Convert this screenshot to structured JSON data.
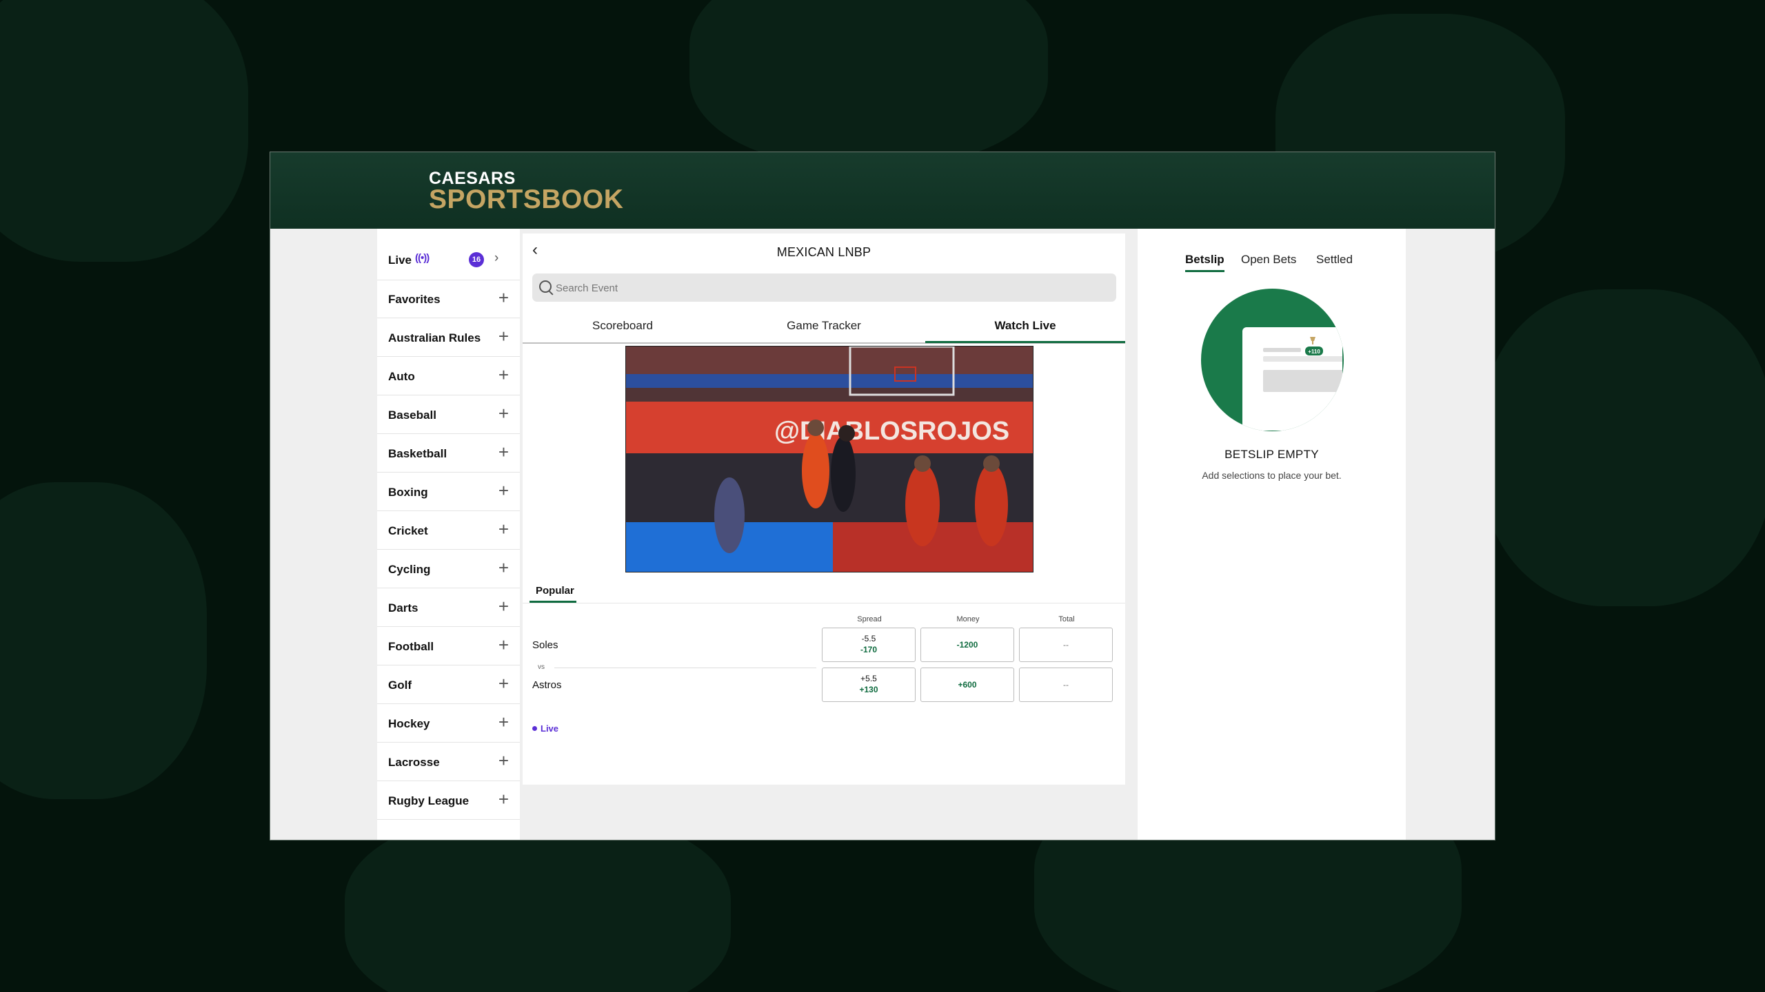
{
  "brand": {
    "line1": "CAESARS",
    "line2": "SPORTSBOOK"
  },
  "sidebar": {
    "live": {
      "label": "Live",
      "count": "16"
    },
    "items": [
      {
        "label": "Favorites"
      },
      {
        "label": "Australian Rules"
      },
      {
        "label": "Auto"
      },
      {
        "label": "Baseball"
      },
      {
        "label": "Basketball"
      },
      {
        "label": "Boxing"
      },
      {
        "label": "Cricket"
      },
      {
        "label": "Cycling"
      },
      {
        "label": "Darts"
      },
      {
        "label": "Football"
      },
      {
        "label": "Golf"
      },
      {
        "label": "Hockey"
      },
      {
        "label": "Lacrosse"
      },
      {
        "label": "Rugby League"
      }
    ]
  },
  "main": {
    "title": "MEXICAN LNBP",
    "search_placeholder": "Search Event",
    "tabs": [
      {
        "label": "Scoreboard"
      },
      {
        "label": "Game Tracker"
      },
      {
        "label": "Watch Live"
      }
    ],
    "active_tab": "Watch Live",
    "video": {
      "banner_text": "@DIABLOSROJOS"
    },
    "section_tab": "Popular",
    "columns": [
      "Spread",
      "Money",
      "Total"
    ],
    "vs_label": "vs",
    "live_label": "Live",
    "teams": [
      {
        "name": "Soles",
        "spread": "-5.5",
        "spread_odds": "-170",
        "money": "-1200",
        "total": "--"
      },
      {
        "name": "Astros",
        "spread": "+5.5",
        "spread_odds": "+130",
        "money": "+600",
        "total": "--"
      }
    ]
  },
  "betslip": {
    "tabs": [
      {
        "label": "Betslip"
      },
      {
        "label": "Open Bets"
      },
      {
        "label": "Settled"
      }
    ],
    "active_tab": "Betslip",
    "illustration_badge": "+110",
    "empty_title": "BETSLIP EMPTY",
    "empty_subtitle": "Add selections to place your bet."
  },
  "colors": {
    "brand_green": "#0f6b3f",
    "header_green": "#173b2c",
    "gold": "#c5a563",
    "live_purple": "#5b2fd6"
  }
}
